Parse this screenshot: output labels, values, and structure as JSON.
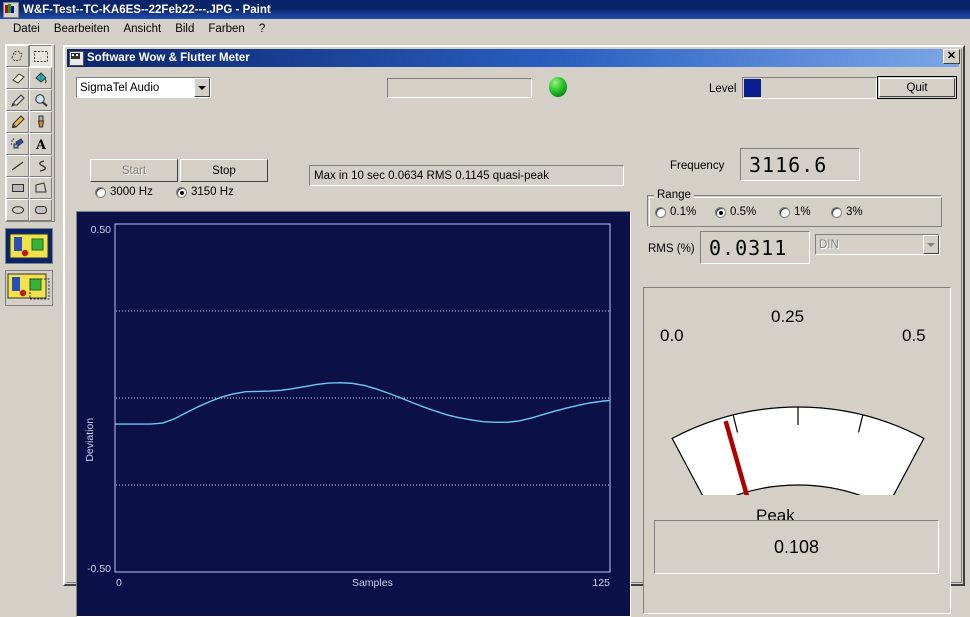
{
  "paint": {
    "title": "W&F-Test--TC-KA6ES--22Feb22---.JPG - Paint",
    "menu": [
      "Datei",
      "Bearbeiten",
      "Ansicht",
      "Bild",
      "Farben",
      "?"
    ],
    "tools": [
      {
        "name": "free-form-select",
        "selected": false
      },
      {
        "name": "rectangle-select",
        "selected": true
      },
      {
        "name": "eraser",
        "selected": false
      },
      {
        "name": "fill-with-color",
        "selected": false
      },
      {
        "name": "pick-color",
        "selected": false
      },
      {
        "name": "magnifier",
        "selected": false
      },
      {
        "name": "pencil",
        "selected": false
      },
      {
        "name": "brush",
        "selected": false
      },
      {
        "name": "airbrush",
        "selected": false
      },
      {
        "name": "text",
        "selected": false
      },
      {
        "name": "line",
        "selected": false
      },
      {
        "name": "curve",
        "selected": false
      },
      {
        "name": "rectangle",
        "selected": false
      },
      {
        "name": "polygon",
        "selected": false
      },
      {
        "name": "ellipse",
        "selected": false
      },
      {
        "name": "rounded-rectangle",
        "selected": false
      }
    ]
  },
  "wf": {
    "title": "Software Wow & Flutter Meter",
    "close_label": "✕",
    "device": {
      "value": "SigmaTel Audio",
      "options": [
        "SigmaTel Audio"
      ]
    },
    "message_field": "",
    "led": {
      "color": "#33cc33",
      "state": "on"
    },
    "level": {
      "label": "Level",
      "fill_percent": 13,
      "color": "#0a1f8c"
    },
    "quit_label": "Quit",
    "start_label": "Start",
    "start_enabled": false,
    "stop_label": "Stop",
    "stop_enabled": true,
    "freq_radios": [
      {
        "label": "3000 Hz",
        "selected": false
      },
      {
        "label": "3150 Hz",
        "selected": true
      }
    ],
    "status_text": "Max in 10 sec 0.0634 RMS 0.1145 quasi-peak",
    "frequency": {
      "label": "Frequency",
      "value": "3116.6"
    },
    "range": {
      "title": "Range",
      "options": [
        {
          "label": "0.1%",
          "selected": false
        },
        {
          "label": "0.5%",
          "selected": true
        },
        {
          "label": "1%",
          "selected": false
        },
        {
          "label": "3%",
          "selected": false
        }
      ]
    },
    "rms": {
      "label": "RMS (%)",
      "value": "0.0311"
    },
    "weighting": {
      "value": "DIN",
      "enabled": false
    },
    "gauge": {
      "scale_left": "0.0",
      "scale_mid": "0.25",
      "scale_right": "0.5",
      "mode_label": "Peak",
      "reading": "0.108",
      "needle_value": 0.108,
      "scale_min": 0.0,
      "scale_max": 0.5,
      "needle_color": "#b00000",
      "face_color": "#ffffff"
    }
  },
  "chart_data": {
    "type": "line",
    "title": "",
    "xlabel": "Samples",
    "ylabel": "Deviation",
    "xlim": [
      0,
      125
    ],
    "ylim": [
      -0.5,
      0.5
    ],
    "xticks": [
      "0",
      "125"
    ],
    "yticks": [
      "0.50",
      "-0.50"
    ],
    "grid": true,
    "gridlines_y": [
      0.25,
      0.0,
      -0.25
    ],
    "background": "#0b1048",
    "line_color": "#6fc8f0",
    "series": [
      {
        "name": "deviation",
        "x": [
          0,
          3,
          6,
          9,
          12,
          15,
          18,
          21,
          24,
          27,
          30,
          33,
          36,
          39,
          42,
          45,
          48,
          51,
          54,
          57,
          60,
          63,
          66,
          69,
          72,
          75,
          78,
          81,
          84,
          87,
          90,
          93,
          96,
          99,
          102,
          105,
          108,
          111,
          114,
          117,
          120,
          123,
          125
        ],
        "y": [
          -0.075,
          -0.075,
          -0.075,
          -0.075,
          -0.072,
          -0.06,
          -0.042,
          -0.025,
          -0.01,
          0.003,
          0.012,
          0.018,
          0.019,
          0.02,
          0.022,
          0.027,
          0.033,
          0.039,
          0.043,
          0.044,
          0.042,
          0.036,
          0.026,
          0.014,
          0.001,
          -0.013,
          -0.026,
          -0.038,
          -0.049,
          -0.057,
          -0.063,
          -0.068,
          -0.07,
          -0.07,
          -0.066,
          -0.058,
          -0.048,
          -0.038,
          -0.029,
          -0.021,
          -0.014,
          -0.009,
          -0.007
        ]
      }
    ]
  }
}
